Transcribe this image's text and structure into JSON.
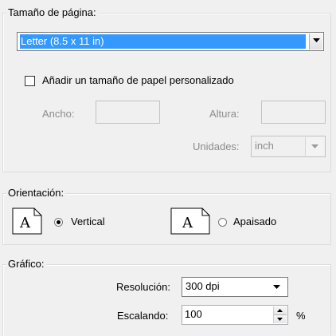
{
  "page_size": {
    "legend": "Tamaño de página:",
    "selected_size": "Letter (8.5 x 11 in)",
    "custom_checkbox_label": "Añadir un tamaño de papel personalizado",
    "custom_checked": false,
    "width_label": "Ancho:",
    "height_label": "Altura:",
    "units_label": "Unidades:",
    "units_value": "inch"
  },
  "orientation": {
    "legend": "Orientación:",
    "portrait_label": "Vertical",
    "landscape_label": "Apaisado",
    "selected": "portrait",
    "page_icon_letter": "A"
  },
  "graphic": {
    "legend": "Gráfico:",
    "resolution_label": "Resolución:",
    "resolution_value": "300 dpi",
    "scaling_label": "Escalando:",
    "scaling_value": "100",
    "scaling_unit": "%"
  }
}
